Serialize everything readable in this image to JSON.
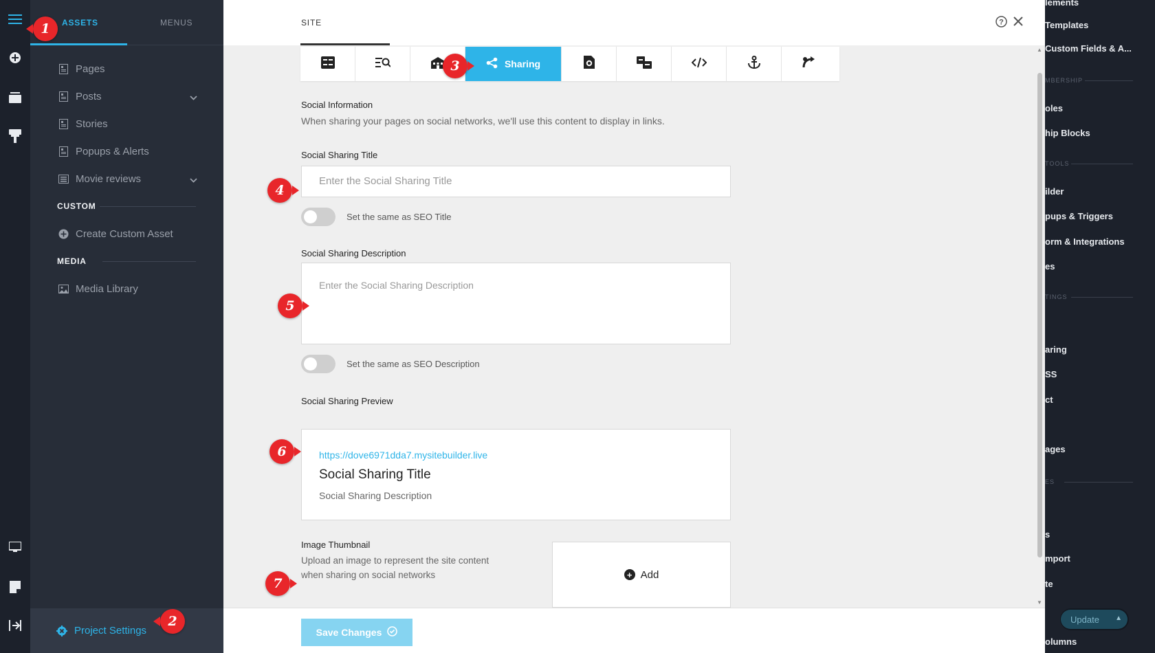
{
  "assets_sidebar": {
    "tabs": [
      {
        "label": "ASSETS"
      },
      {
        "label": "MENUS"
      }
    ],
    "items": [
      {
        "label": "Pages",
        "icon": "page-icon",
        "chevron": false
      },
      {
        "label": "Posts",
        "icon": "page-icon",
        "chevron": true
      },
      {
        "label": "Stories",
        "icon": "page-icon",
        "chevron": false
      },
      {
        "label": "Popups & Alerts",
        "icon": "page-icon",
        "chevron": false
      },
      {
        "label": "Movie reviews",
        "icon": "list-icon",
        "chevron": true
      }
    ],
    "custom_heading": "CUSTOM",
    "create_custom": "Create Custom Asset",
    "media_heading": "MEDIA",
    "media_library": "Media Library",
    "project_settings": "Project Settings"
  },
  "dialog": {
    "site_tab": "SITE",
    "sharing_tab": "Sharing",
    "social_info_title": "Social Information",
    "social_info_desc": "When sharing your pages on social networks, we'll use this content to display in links.",
    "title_label": "Social Sharing Title",
    "title_placeholder": "Enter the Social Sharing Title",
    "title_toggle": "Set the same as SEO Title",
    "desc_label": "Social Sharing Description",
    "desc_placeholder": "Enter the Social Sharing Description",
    "desc_toggle": "Set the same as SEO Description",
    "preview_label": "Social Sharing Preview",
    "preview_url": "https://dove6971dda7.mysitebuilder.live",
    "preview_title": "Social Sharing Title",
    "preview_desc": "Social Sharing Description",
    "thumb_label": "Image Thumbnail",
    "thumb_desc_1": "Upload an image to represent the site content",
    "thumb_desc_2": "when sharing on social networks",
    "add_label": "Add",
    "save_label": "Save Changes"
  },
  "right_panel": {
    "items": [
      {
        "label": "lements",
        "y": -4
      },
      {
        "label": "Templates",
        "y": 29
      },
      {
        "label": "Custom Fields & A...",
        "y": 63
      }
    ],
    "section_1": "MBERSHIP",
    "items_2": [
      "oles",
      "hip Blocks"
    ],
    "section_2": "TOOLS",
    "items_3": [
      "ilder",
      "pups & Triggers",
      "orm & Integrations",
      "es"
    ],
    "section_3": "TINGS",
    "items_4": [
      "aring",
      "SS",
      "ct",
      "ages"
    ],
    "section_4": "ES",
    "items_5": [
      "s",
      "mport",
      "te"
    ],
    "bottom": "olumns",
    "update_label": "Update"
  },
  "callouts": [
    "1",
    "2",
    "3",
    "4",
    "5",
    "6",
    "7"
  ],
  "colors": {
    "accent": "#2eb4e8",
    "callout": "#e8262a",
    "sidebar": "#272d38"
  }
}
